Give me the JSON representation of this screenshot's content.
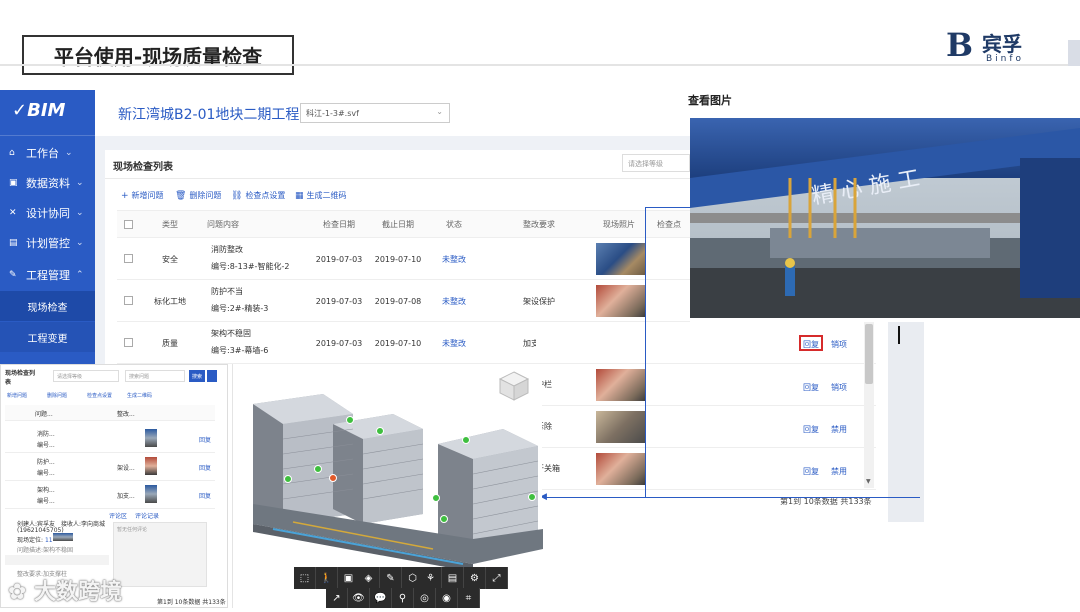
{
  "slide": {
    "title": "平台使用-现场质量检查",
    "logo_text": "宾孚",
    "logo_sub": "Binfo",
    "watermark": "大数跨境"
  },
  "app": {
    "brand": "BIM",
    "project_title": "新江湾城B2-01地块二期工程",
    "file_select": "科江-1-3#.svf",
    "nav": [
      {
        "label": "工作台",
        "icon": "home-icon"
      },
      {
        "label": "数据资料",
        "icon": "database-icon"
      },
      {
        "label": "设计协同",
        "icon": "tools-icon"
      },
      {
        "label": "计划管控",
        "icon": "calendar-icon"
      },
      {
        "label": "工程管理",
        "icon": "wrench-icon"
      }
    ],
    "nav_sub": [
      "现场检查",
      "工程变更"
    ],
    "panel": {
      "title": "现场检查列表",
      "select_placeholder": "请选择等级",
      "tools": [
        "新增问题",
        "删除问题",
        "检查点设置",
        "生成二维码"
      ],
      "columns": [
        "类型",
        "问题内容",
        "检查日期",
        "截止日期",
        "状态",
        "整改要求",
        "现场照片",
        "检查点"
      ],
      "rows": [
        {
          "type": "安全",
          "issue": "消防整改",
          "code": "编号:8-13#-智能化-2",
          "check_date": "2019-07-03",
          "due_date": "2019-07-10",
          "status": "未整改",
          "req": ""
        },
        {
          "type": "标化工地",
          "issue": "防护不当",
          "code": "编号:2#-精装-3",
          "check_date": "2019-07-03",
          "due_date": "2019-07-08",
          "status": "未整改",
          "req": "架设保护"
        },
        {
          "type": "质量",
          "issue": "架构不稳固",
          "code": "编号:3#-幕墙-6",
          "check_date": "2019-07-03",
          "due_date": "2019-07-10",
          "status": "未整改",
          "req": "加支撑柱"
        }
      ]
    },
    "lower_rows": [
      {
        "req": "护栏",
        "actions": [
          "回复",
          "销项"
        ]
      },
      {
        "req": "拆除",
        "actions": [
          "回复",
          "禁用"
        ]
      },
      {
        "req": "开关箱",
        "actions": [
          "回复",
          "禁用"
        ]
      }
    ],
    "row3_actions": [
      "回复",
      "销项"
    ],
    "pager": "第1到 10条数据 共133条"
  },
  "viewer": {
    "title": "查看图片"
  },
  "mini": {
    "title": "现场检查列表",
    "select": "请选择等级",
    "search": "搜索问题",
    "search_btn": "搜索",
    "tools": [
      "新增问题",
      "删除问题",
      "检查点设置",
      "生成二维码"
    ],
    "col_issue": "问题...",
    "col_req": "整改...",
    "rows": [
      {
        "l1": "消防...",
        "l2": "编号...",
        "req": "",
        "action": "回复"
      },
      {
        "l1": "防护...",
        "l2": "编号...",
        "req": "架设...",
        "action": "回复"
      },
      {
        "l1": "架构...",
        "l2": "编号...",
        "req": "加支...",
        "action": "回复"
      }
    ],
    "tab_comment": "评论区",
    "tab_record": "评论记录",
    "creator_label": "创建人:",
    "creator": "宾孚友",
    "recv_label": "接收人:",
    "recv": "李向商城",
    "phone": "(19621045705)",
    "location_label": "现场定位:",
    "location_count": "11",
    "desc_label": "问题描述:",
    "desc": "架构不稳固",
    "req_label": "整改要求:",
    "req": "加支撑柱",
    "comment_placeholder": "暂无任何评论",
    "pager": "第1到 10条数据 共133条"
  }
}
